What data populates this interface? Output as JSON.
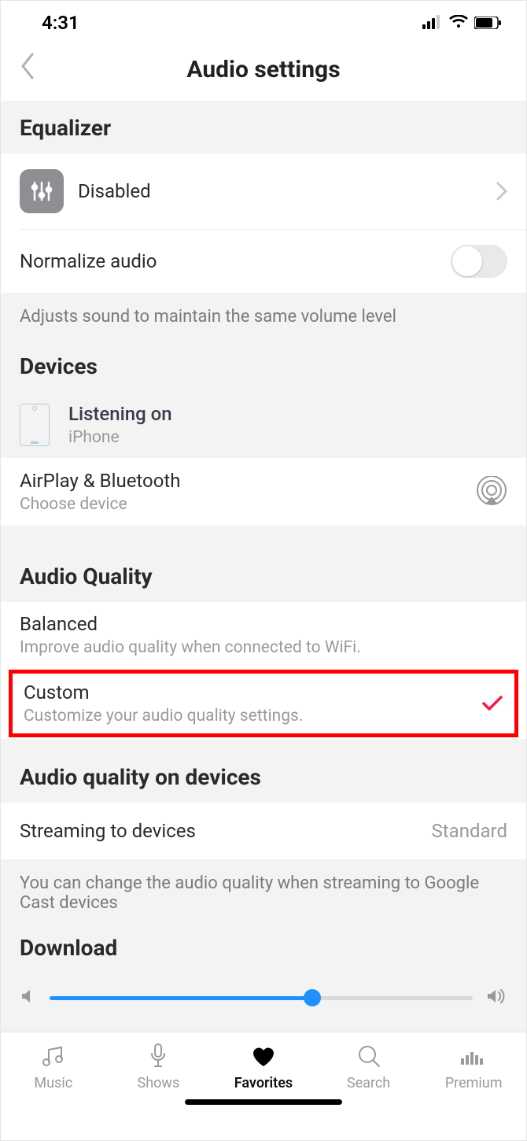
{
  "status": {
    "time": "4:31"
  },
  "nav": {
    "title": "Audio settings"
  },
  "equalizer": {
    "header": "Equalizer",
    "value": "Disabled",
    "normalize_label": "Normalize audio",
    "normalize_desc": "Adjusts sound to maintain the same volume level"
  },
  "devices": {
    "header": "Devices",
    "listening_label": "Listening on",
    "listening_device": "iPhone",
    "airplay_label": "AirPlay & Bluetooth",
    "airplay_sub": "Choose device"
  },
  "quality": {
    "header": "Audio Quality",
    "balanced_label": "Balanced",
    "balanced_sub": "Improve audio quality when connected to WiFi.",
    "custom_label": "Custom",
    "custom_sub": "Customize your audio quality settings."
  },
  "quality_devices": {
    "header": "Audio quality on devices",
    "streaming_label": "Streaming to devices",
    "streaming_value": "Standard",
    "streaming_desc": "You can change the audio quality when streaming to Google Cast devices"
  },
  "download": {
    "header": "Download"
  },
  "tabs": {
    "music": "Music",
    "shows": "Shows",
    "favorites": "Favorites",
    "search": "Search",
    "premium": "Premium"
  }
}
